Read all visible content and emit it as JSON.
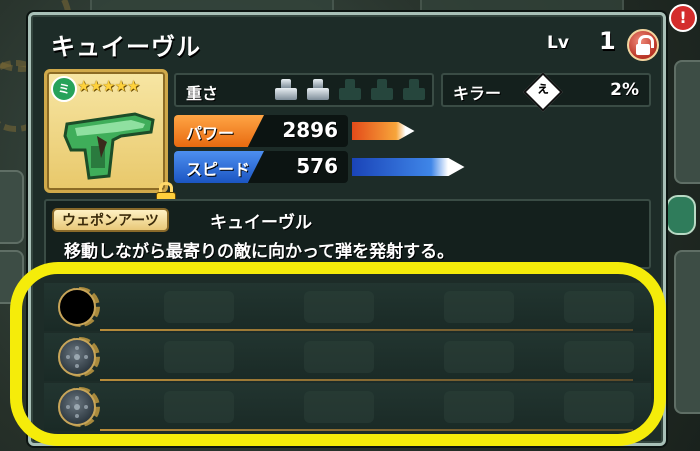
{
  "dialog": {
    "weapon_name": "キュイーヴル",
    "level_label": "Lv",
    "level_value": "1"
  },
  "thumbnail": {
    "type_badge": "ミ",
    "rarity": "★★★★★",
    "rarity_count": 5
  },
  "stats": {
    "weight_label": "重さ",
    "weight_active": 2,
    "weight_max": 5,
    "killer_label": "キラー",
    "killer_icon": "ぇ",
    "killer_value": "2%",
    "power_label": "パワー",
    "power_value": "2896",
    "power_gauge_fraction": 0.25,
    "speed_label": "スピード",
    "speed_value": "576",
    "speed_gauge_fraction": 0.45
  },
  "description": {
    "tag": "ウェポンアーツ",
    "arts_name": "キュイーヴル",
    "text": "移動しながら最寄りの敵に向かって弾を発射する。"
  },
  "slots": [
    {
      "state": "empty"
    },
    {
      "state": "locked"
    },
    {
      "state": "locked"
    }
  ],
  "alert_badge": "!",
  "colors": {
    "power": "#f07a1a",
    "speed": "#2a6fd6",
    "highlight": "#f5ec0a",
    "lock": "#b83324"
  }
}
